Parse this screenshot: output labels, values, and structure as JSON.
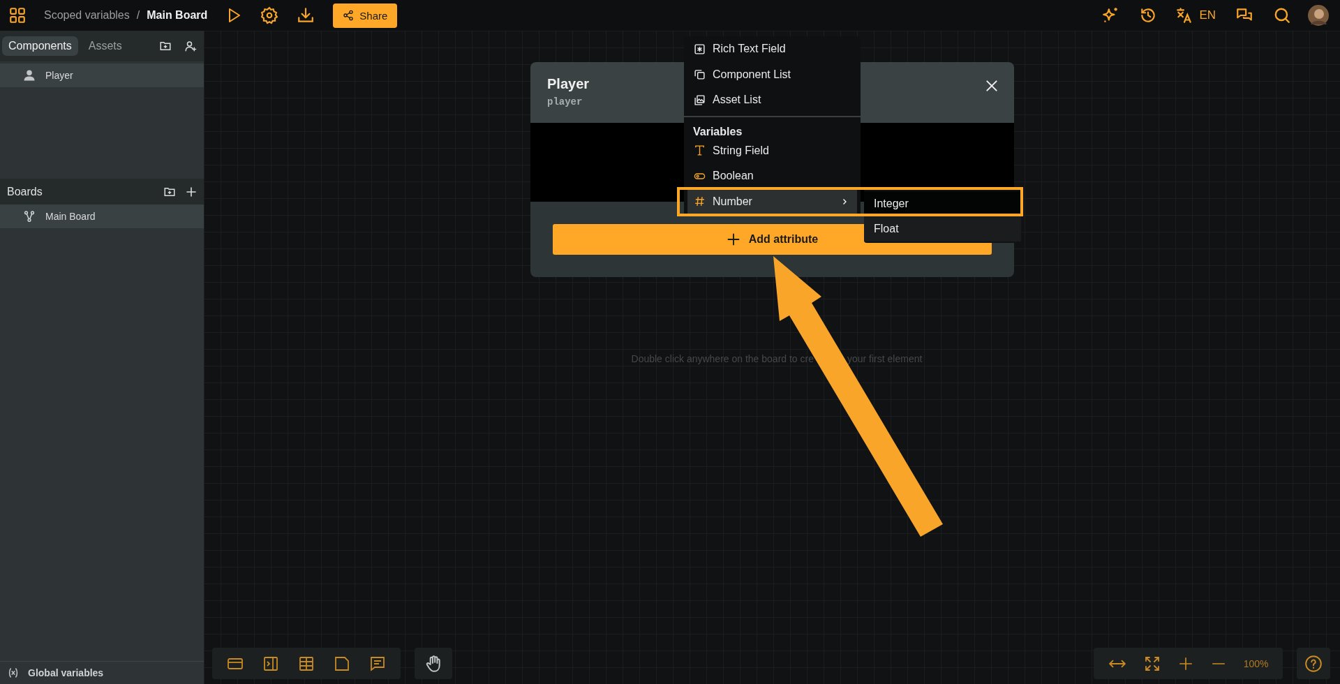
{
  "topbar": {
    "breadcrumb": [
      {
        "label": "Scoped variables",
        "current": false
      },
      {
        "label": "Main Board",
        "current": true
      }
    ],
    "separator": "/",
    "share": "Share",
    "language": "EN"
  },
  "sidebar": {
    "tabs": [
      {
        "label": "Components",
        "selected": true
      },
      {
        "label": "Assets",
        "selected": false
      }
    ],
    "components": [
      {
        "label": "Player",
        "selected": true
      }
    ],
    "boards_title": "Boards",
    "boards": [
      {
        "label": "Main Board",
        "selected": true
      }
    ],
    "footer": "Global variables"
  },
  "dialog": {
    "title": "Player",
    "subtitle": "player",
    "add_button": "Add attribute"
  },
  "menu": {
    "sections": [
      {
        "items": [
          {
            "label": "Rich Text Field",
            "selected": false
          },
          {
            "label": "Component List",
            "selected": false
          },
          {
            "label": "Asset List",
            "selected": false
          }
        ]
      },
      {
        "heading": "Variables",
        "items": [
          {
            "label": "String Field",
            "selected": false
          },
          {
            "label": "Boolean",
            "selected": false
          },
          {
            "label": "Number",
            "selected": true,
            "expanded": true,
            "children": [
              {
                "label": "Integer",
                "selected": true
              },
              {
                "label": "Float",
                "selected": false
              }
            ]
          }
        ]
      }
    ]
  },
  "canvas": {
    "hint_parts": [
      "Double click anywhere on the board to cre",
      "your first element"
    ]
  },
  "zoom": {
    "reading": "100%"
  }
}
